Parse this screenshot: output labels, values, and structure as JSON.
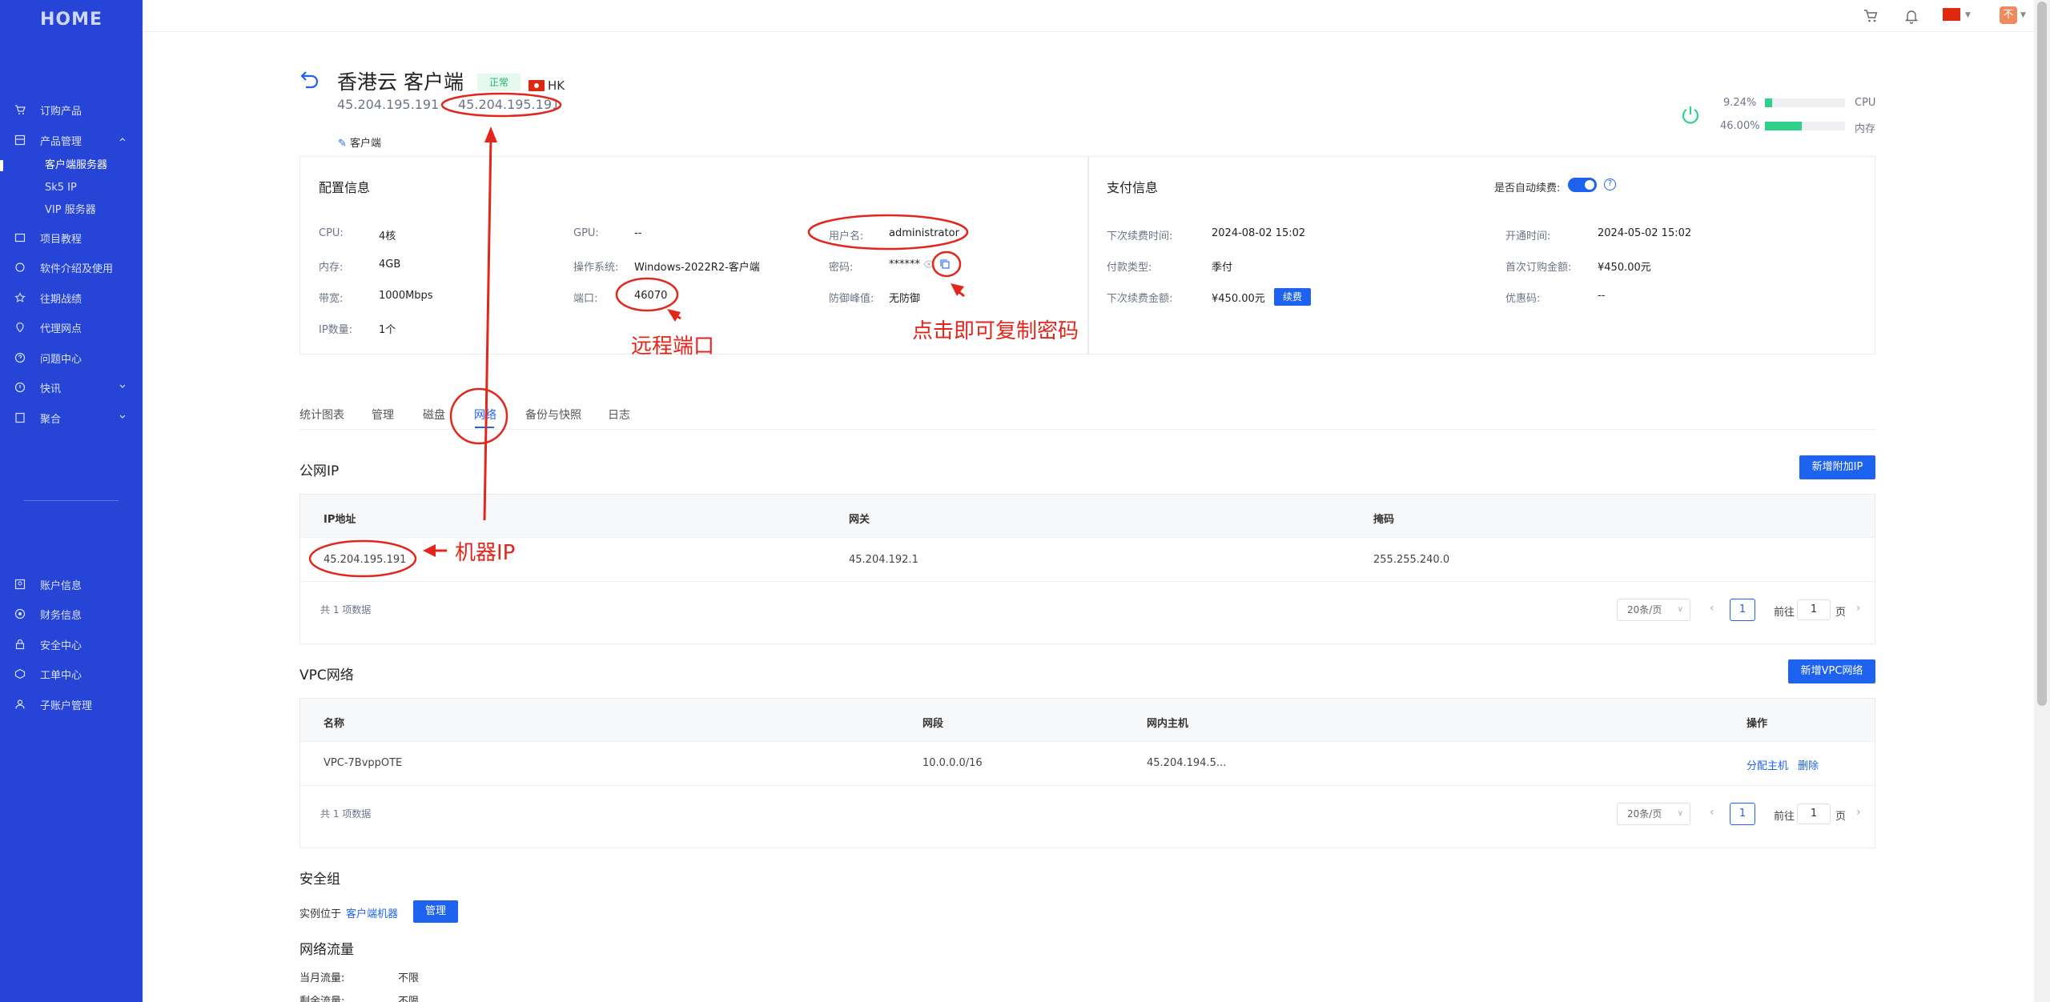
{
  "sidebar": {
    "logo": "HOME",
    "items": [
      {
        "label": "订购产品",
        "icon": "cart-icon"
      },
      {
        "label": "产品管理",
        "icon": "product-icon"
      },
      {
        "label": "项目教程",
        "icon": "tutorial-icon"
      },
      {
        "label": "软件介绍及使用",
        "icon": "software-icon"
      },
      {
        "label": "往期战绩",
        "icon": "star-icon"
      },
      {
        "label": "代理网点",
        "icon": "proxy-icon"
      },
      {
        "label": "问题中心",
        "icon": "question-icon"
      },
      {
        "label": "快讯",
        "icon": "news-icon"
      },
      {
        "label": "聚合",
        "icon": "aggregate-icon"
      },
      {
        "label": "账户信息",
        "icon": "account-icon"
      },
      {
        "label": "财务信息",
        "icon": "finance-icon"
      },
      {
        "label": "安全中心",
        "icon": "lock-icon"
      },
      {
        "label": "工单中心",
        "icon": "ticket-icon"
      },
      {
        "label": "子账户管理",
        "icon": "subaccount-icon"
      }
    ],
    "sub_items": [
      "客户端服务器",
      "Sk5 IP",
      "VIP 服务器"
    ]
  },
  "topbar": {
    "avatar_text": "不"
  },
  "header": {
    "title": "香港云 客户端",
    "status": "正常",
    "region": "HK",
    "ip_primary": "45.204.195.191",
    "ip_secondary": "45.204.195.191",
    "client_link": "客户端"
  },
  "usage": {
    "cpu_value": "9.24%",
    "cpu_label": "CPU",
    "cpu_fraction": 0.0924,
    "mem_value": "46.00%",
    "mem_label": "内存",
    "mem_fraction": 0.46
  },
  "config": {
    "title": "配置信息",
    "cpu_label": "CPU:",
    "cpu": "4核",
    "gpu_label": "GPU:",
    "gpu": "--",
    "user_label": "用户名:",
    "user": "administrator",
    "mem_label": "内存:",
    "mem": "4GB",
    "os_label": "操作系统:",
    "os": "Windows-2022R2-客户端",
    "pwd_label": "密码:",
    "pwd": "******",
    "bw_label": "带宽:",
    "bw": "1000Mbps",
    "port_label": "端口:",
    "port": "46070",
    "ddos_label": "防御峰值:",
    "ddos": "无防御",
    "ipcount_label": "IP数量:",
    "ipcount": "1个"
  },
  "payment": {
    "title": "支付信息",
    "auto_renew_label": "是否自动续费:",
    "next_renew_label": "下次续费时间:",
    "next_renew": "2024-08-02 15:02",
    "open_label": "开通时间:",
    "open": "2024-05-02 15:02",
    "paytype_label": "付款类型:",
    "paytype": "季付",
    "first_amount_label": "首次订购金额:",
    "first_amount": "¥450.00元",
    "next_amount_label": "下次续费金额:",
    "next_amount": "¥450.00元",
    "renew_btn": "续费",
    "coupon_label": "优惠码:",
    "coupon": "--"
  },
  "tabs": [
    "统计图表",
    "管理",
    "磁盘",
    "网络",
    "备份与快照",
    "日志"
  ],
  "public_ip": {
    "title": "公网IP",
    "add_btn": "新增附加IP",
    "headers": [
      "IP地址",
      "网关",
      "掩码"
    ],
    "row": [
      "45.204.195.191",
      "45.204.192.1",
      "255.255.240.0"
    ],
    "total": "共 1 项数据",
    "page_size": "20条/页",
    "page": "1",
    "goto_label": "前往",
    "goto_value": "1",
    "page_unit": "页"
  },
  "vpc": {
    "title": "VPC网络",
    "add_btn": "新增VPC网络",
    "headers": [
      "名称",
      "网段",
      "网内主机",
      "操作"
    ],
    "row": [
      "VPC-7BvppOTE",
      "10.0.0.0/16",
      "45.204.194.5..."
    ],
    "action_assign": "分配主机",
    "action_delete": "删除",
    "total": "共 1 项数据",
    "page_size": "20条/页",
    "page": "1",
    "goto_label": "前往",
    "goto_value": "1",
    "page_unit": "页"
  },
  "security": {
    "title": "安全组",
    "location_label": "实例位于",
    "location_link": "客户端机器",
    "manage_btn": "管理"
  },
  "traffic": {
    "title": "网络流量",
    "month_label": "当月流量:",
    "month_value": "不限",
    "remain_label": "剩余流量:",
    "remain_value": "不限"
  },
  "annotations": {
    "port": "远程端口",
    "copy": "点击即可复制密码",
    "machine_ip": "机器IP"
  },
  "colors": {
    "sidebar": "#2645d6",
    "primary": "#1e63f0",
    "annotation": "#e3261c",
    "status_green": "#22b36a"
  }
}
